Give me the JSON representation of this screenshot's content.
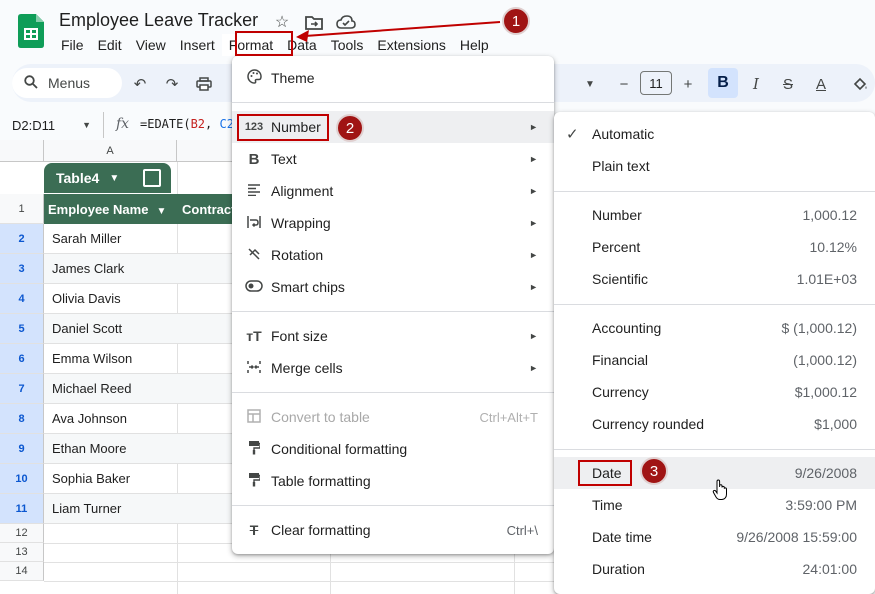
{
  "app": {
    "title": "Employee Leave Tracker"
  },
  "menubar": [
    "File",
    "Edit",
    "View",
    "Insert",
    "Format",
    "Data",
    "Tools",
    "Extensions",
    "Help"
  ],
  "toolbar": {
    "search_label": "Menus",
    "font_size": "11",
    "bold": "B",
    "italic": "I",
    "strike": "S",
    "text_color": "A"
  },
  "formula_bar": {
    "name_box": "D2:D11",
    "fx": "fx",
    "formula_prefix": "=EDATE(",
    "ref1": "B2",
    "sep": ", ",
    "ref2": "C2"
  },
  "sheet": {
    "col_a": "A",
    "table_name": "Table4",
    "headers": [
      "Employee Name",
      "Contract"
    ],
    "row_numbers": [
      "1",
      "2",
      "3",
      "4",
      "5",
      "6",
      "7",
      "8",
      "9",
      "10",
      "11",
      "12",
      "13",
      "14"
    ],
    "names": [
      "Sarah Miller",
      "James Clark",
      "Olivia Davis",
      "Daniel Scott",
      "Emma Wilson",
      "Michael Reed",
      "Ava Johnson",
      "Ethan Moore",
      "Sophia Baker",
      "Liam Turner"
    ]
  },
  "format_menu": {
    "items": [
      {
        "icon": "palette-icon",
        "label": "Theme"
      },
      {
        "icon": "number-format-icon",
        "label": "Number",
        "glyph": "123"
      },
      {
        "icon": "bold-icon",
        "label": "Text"
      },
      {
        "icon": "align-icon",
        "label": "Alignment"
      },
      {
        "icon": "wrap-icon",
        "label": "Wrapping"
      },
      {
        "icon": "rotation-icon",
        "label": "Rotation"
      },
      {
        "icon": "smart-chips-icon",
        "label": "Smart chips"
      },
      {
        "icon": "font-size-icon",
        "label": "Font size"
      },
      {
        "icon": "merge-icon",
        "label": "Merge cells"
      },
      {
        "icon": "table-icon",
        "label": "Convert to table",
        "shortcut": "Ctrl+Alt+T"
      },
      {
        "icon": "paint-roller-icon",
        "label": "Conditional formatting"
      },
      {
        "icon": "paint-roller-icon",
        "label": "Table formatting"
      },
      {
        "icon": "clear-format-icon",
        "label": "Clear formatting",
        "shortcut": "Ctrl+\\"
      }
    ]
  },
  "number_menu": {
    "items": [
      {
        "label": "Automatic",
        "checked": true
      },
      {
        "label": "Plain text"
      },
      {
        "label": "Number",
        "example": "1,000.12"
      },
      {
        "label": "Percent",
        "example": "10.12%"
      },
      {
        "label": "Scientific",
        "example": "1.01E+03"
      },
      {
        "label": "Accounting",
        "example": "$ (1,000.12)"
      },
      {
        "label": "Financial",
        "example": "(1,000.12)"
      },
      {
        "label": "Currency",
        "example": "$1,000.12"
      },
      {
        "label": "Currency rounded",
        "example": "$1,000"
      },
      {
        "label": "Date",
        "example": "9/26/2008"
      },
      {
        "label": "Time",
        "example": "3:59:00 PM"
      },
      {
        "label": "Date time",
        "example": "9/26/2008 15:59:00"
      },
      {
        "label": "Duration",
        "example": "24:01:00"
      }
    ]
  },
  "callouts": [
    "1",
    "2",
    "3"
  ],
  "colors": {
    "accent_red": "#c00000",
    "badge": "#a01414",
    "table_green": "#3b6d54",
    "selection": "#d3e3fd"
  }
}
